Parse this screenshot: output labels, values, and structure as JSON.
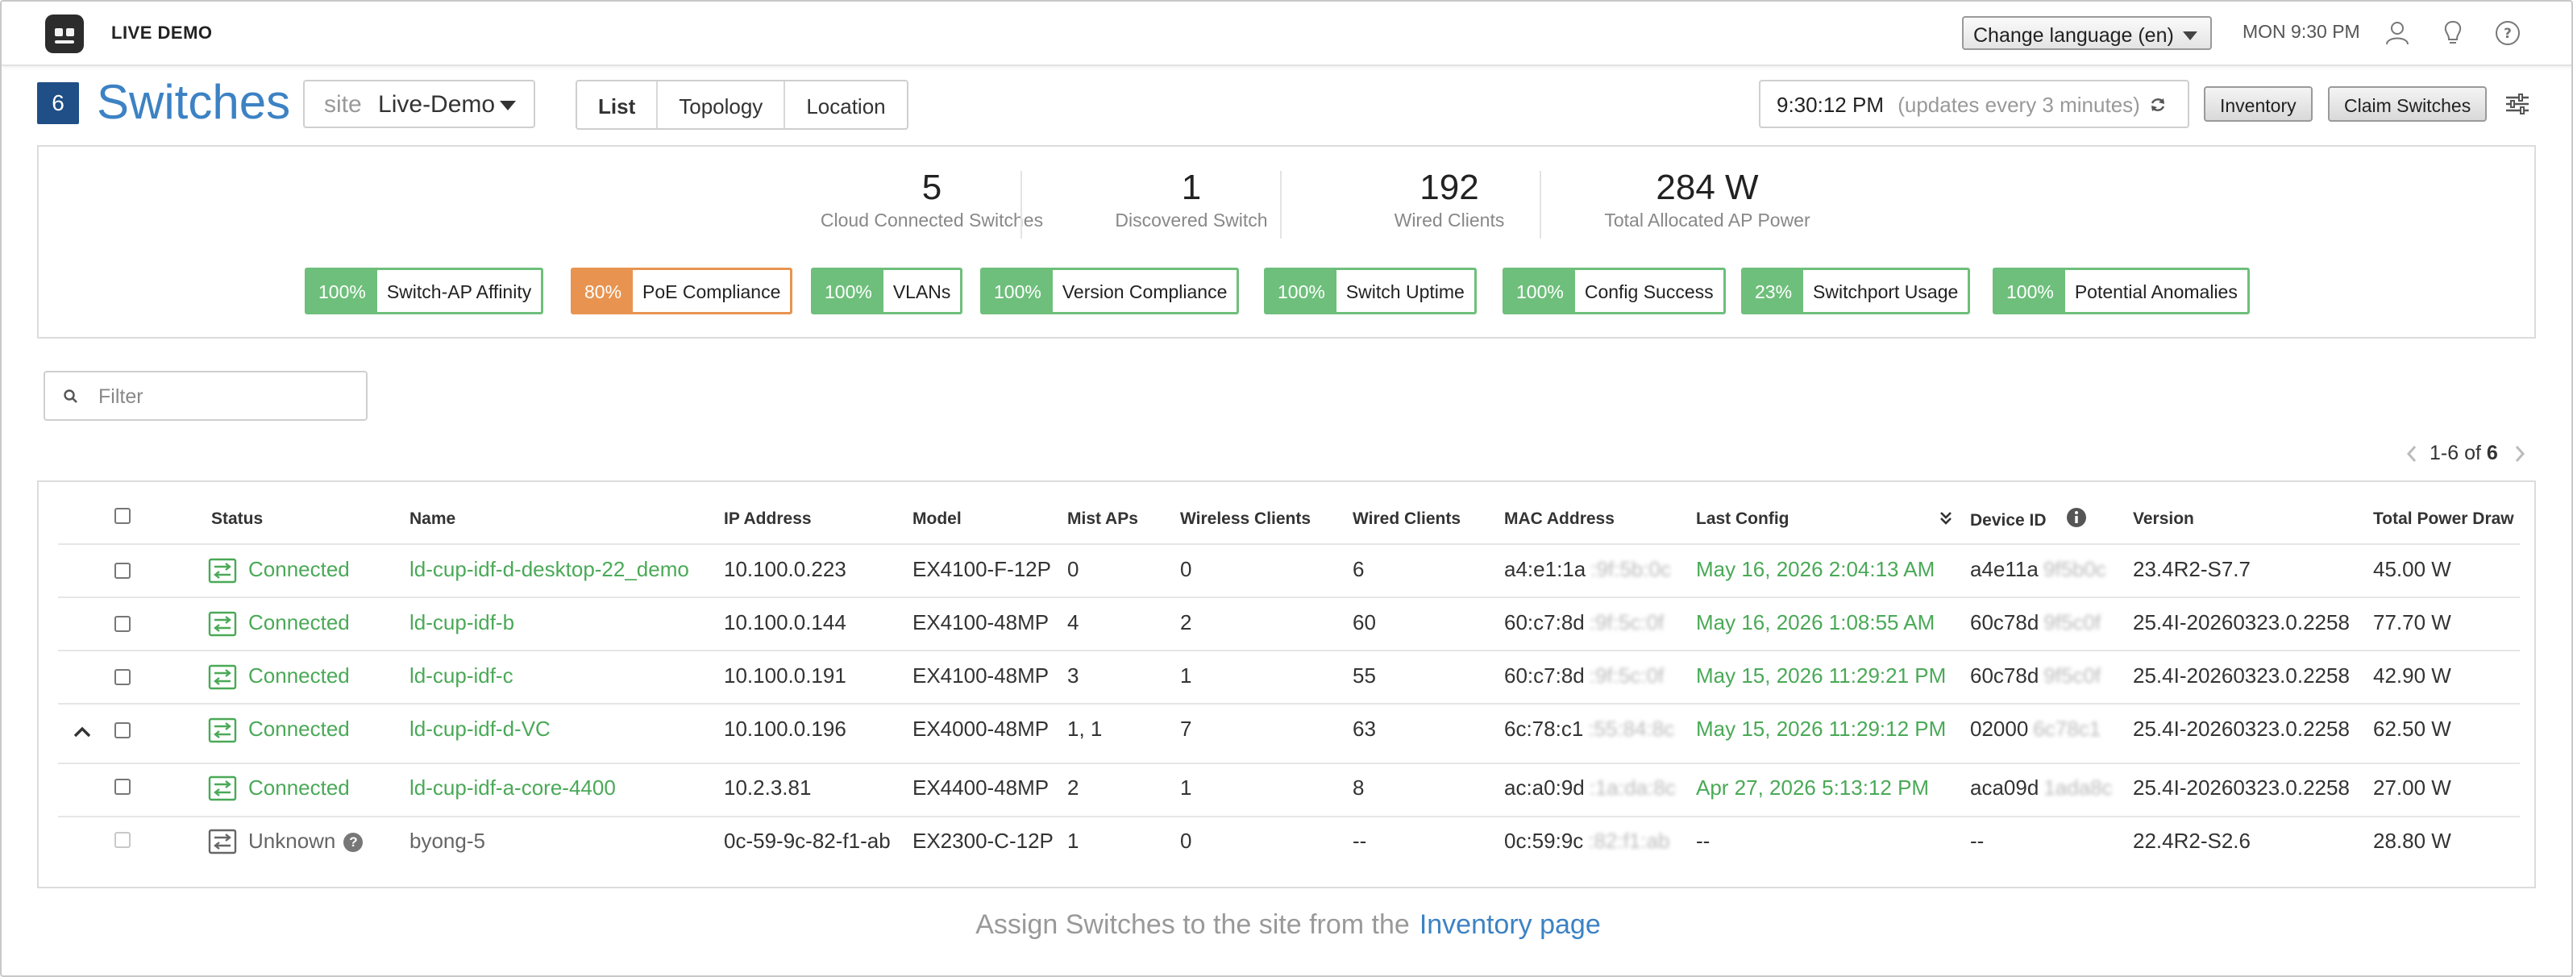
{
  "brand": "LIVE DEMO",
  "topbar": {
    "language_label": "Change language (en)",
    "clock": "MON 9:30 PM"
  },
  "header": {
    "count": "6",
    "title": "Switches",
    "site_label": "site",
    "site_value": "Live-Demo",
    "tabs": [
      "List",
      "Topology",
      "Location"
    ],
    "active_tab": "List",
    "update_time": "9:30:12 PM",
    "update_note": "(updates every 3 minutes)",
    "inventory_button": "Inventory",
    "claim_button": "Claim Switches"
  },
  "stats": [
    {
      "value": "5",
      "label": "Cloud Connected Switches"
    },
    {
      "value": "1",
      "label": "Discovered Switch"
    },
    {
      "value": "192",
      "label": "Wired Clients"
    },
    {
      "value": "284 W",
      "label": "Total Allocated AP Power"
    }
  ],
  "metrics": [
    {
      "pct": "100%",
      "label": "Switch-AP Affinity",
      "color": "#6ebf7b"
    },
    {
      "pct": "80%",
      "label": "PoE Compliance",
      "color": "#e89450"
    },
    {
      "pct": "100%",
      "label": "VLANs",
      "color": "#6ebf7b"
    },
    {
      "pct": "100%",
      "label": "Version Compliance",
      "color": "#6ebf7b"
    },
    {
      "pct": "100%",
      "label": "Switch Uptime",
      "color": "#6ebf7b"
    },
    {
      "pct": "100%",
      "label": "Config Success",
      "color": "#6ebf7b"
    },
    {
      "pct": "23%",
      "label": "Switchport Usage",
      "color": "#6ebf7b"
    },
    {
      "pct": "100%",
      "label": "Potential Anomalies",
      "color": "#6ebf7b"
    }
  ],
  "filter": {
    "placeholder": "Filter"
  },
  "pager": {
    "range": "1-6 of",
    "total": "6"
  },
  "table": {
    "columns": [
      "Status",
      "Name",
      "IP Address",
      "Model",
      "Mist APs",
      "Wireless Clients",
      "Wired Clients",
      "MAC Address",
      "Last Config",
      "Device ID",
      "Version",
      "Total Power Draw"
    ],
    "rows": [
      {
        "status": "Connected",
        "name": "ld-cup-idf-d-desktop-22_demo",
        "ip": "10.100.0.223",
        "model": "EX4100-F-12P",
        "aps": "0",
        "wireless": "0",
        "wired": "6",
        "mac": "a4:e1:1a",
        "mac_hidden": ":9f:5b:0c",
        "last_config": "May 16, 2026 2:04:13 AM",
        "device_id": "a4e11a",
        "device_id_hidden": "9f5b0c",
        "version": "23.4R2-S7.7",
        "power": "45.00 W"
      },
      {
        "status": "Connected",
        "name": "ld-cup-idf-b",
        "ip": "10.100.0.144",
        "model": "EX4100-48MP",
        "aps": "4",
        "wireless": "2",
        "wired": "60",
        "mac": "60:c7:8d",
        "mac_hidden": ":9f:5c:0f",
        "last_config": "May 16, 2026 1:08:55 AM",
        "device_id": "60c78d",
        "device_id_hidden": "9f5c0f",
        "version": "25.4I-20260323.0.2258",
        "power": "77.70 W"
      },
      {
        "status": "Connected",
        "name": "ld-cup-idf-c",
        "ip": "10.100.0.191",
        "model": "EX4100-48MP",
        "aps": "3",
        "wireless": "1",
        "wired": "55",
        "mac": "60:c7:8d",
        "mac_hidden": ":9f:5c:0f",
        "last_config": "May 15, 2026 11:29:21 PM",
        "device_id": "60c78d",
        "device_id_hidden": "9f5c0f",
        "version": "25.4I-20260323.0.2258",
        "power": "42.90 W"
      },
      {
        "status": "Connected",
        "name": "ld-cup-idf-d-VC",
        "ip": "10.100.0.196",
        "model": "EX4000-48MP",
        "aps": "1, 1",
        "wireless": "7",
        "wired": "63",
        "mac": "6c:78:c1",
        "mac_hidden": ":55:84:8c",
        "last_config": "May 15, 2026 11:29:12 PM",
        "device_id": "02000",
        "device_id_hidden": "6c78c1",
        "version": "25.4I-20260323.0.2258",
        "power": "62.50 W"
      },
      {
        "status": "Connected",
        "name": "ld-cup-idf-a-core-4400",
        "ip": "10.2.3.81",
        "model": "EX4400-48MP",
        "aps": "2",
        "wireless": "1",
        "wired": "8",
        "mac": "ac:a0:9d",
        "mac_hidden": ":1a:da:8c",
        "last_config": "Apr 27, 2026 5:13:12 PM",
        "device_id": "aca09d",
        "device_id_hidden": "1ada8c",
        "version": "25.4I-20260323.0.2258",
        "power": "27.00 W"
      },
      {
        "status": "Unknown",
        "name": "byong-5",
        "ip": "0c-59-9c-82-f1-ab",
        "model": "EX2300-C-12P",
        "aps": "1",
        "wireless": "0",
        "wired": "--",
        "mac": "0c:59:9c",
        "mac_hidden": ":82:f1:ab",
        "last_config": "--",
        "device_id": "--",
        "device_id_hidden": "",
        "version": "22.4R2-S2.6",
        "power": "28.80 W"
      }
    ]
  },
  "footer": {
    "text": "Assign Switches to the site from the",
    "link": "Inventory page"
  },
  "colors": {
    "accent": "#3c82c4",
    "connected": "#4aa957",
    "badge_green": "#6ebf7b",
    "badge_orange": "#e89450",
    "site_badge": "#1f4f86"
  }
}
